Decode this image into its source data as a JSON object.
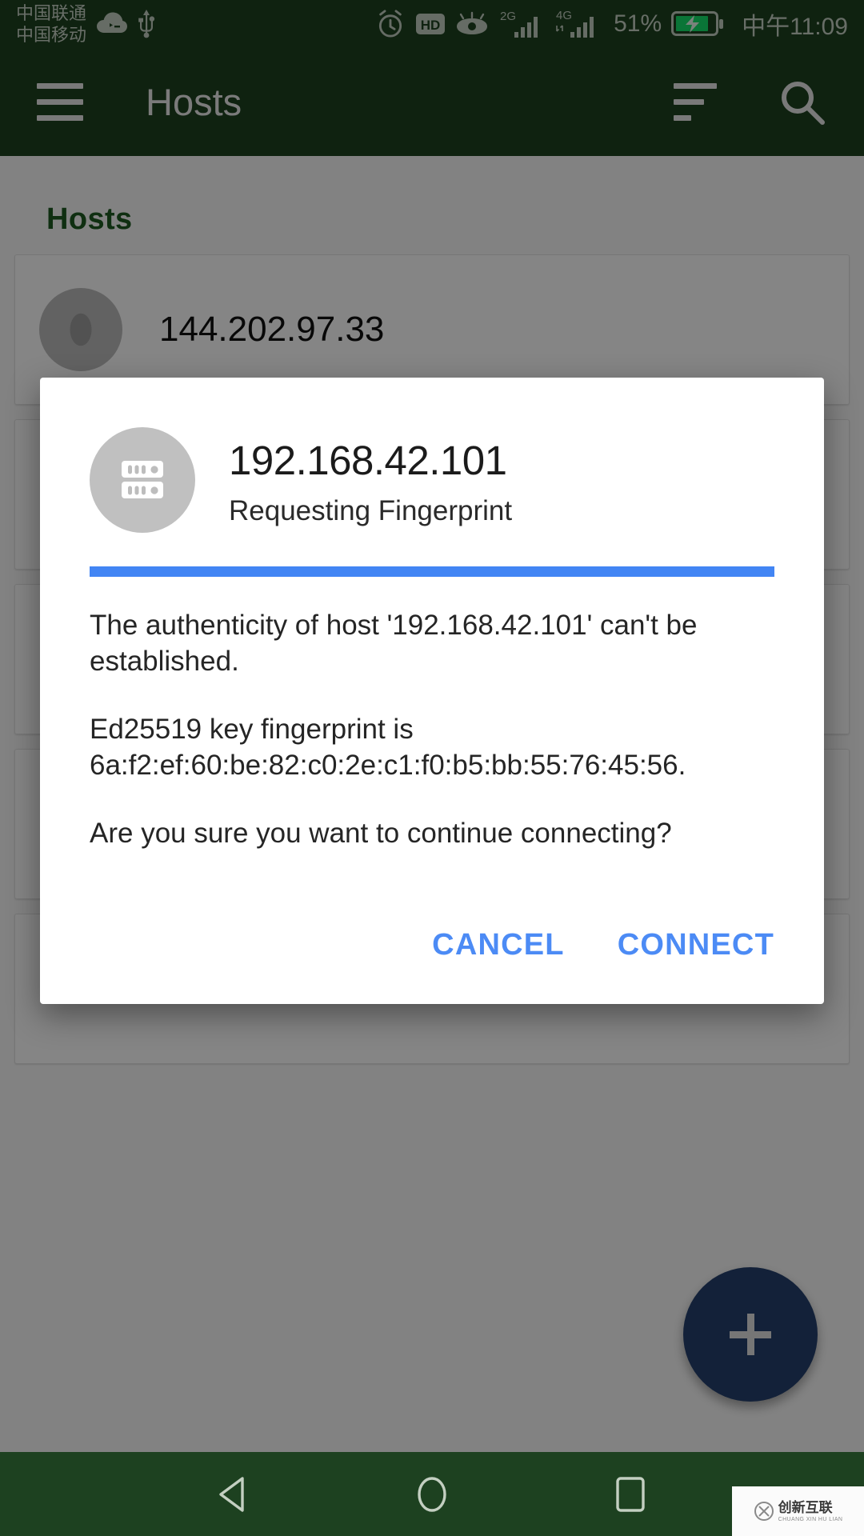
{
  "status_bar": {
    "carrier_line1": "中国联通",
    "carrier_line2": "中国移动",
    "icons": [
      "weather-cloud-icon",
      "usb-icon",
      "alarm-icon",
      "hd-icon",
      "eye-icon",
      "signal-2g-icon",
      "signal-4g-icon"
    ],
    "network_2g_label": "2G",
    "network_4g_label": "4G",
    "battery_percent": "51%",
    "battery_state": "charging",
    "time": "中午11:09"
  },
  "app_bar": {
    "menu_icon": "hamburger-menu-icon",
    "title": "Hosts",
    "sort_icon": "sort-icon",
    "search_icon": "search-icon"
  },
  "content": {
    "section_title": "Hosts",
    "hosts": [
      {
        "label": "144.202.97.33"
      },
      {
        "label": ""
      },
      {
        "label": ""
      },
      {
        "label": ""
      },
      {
        "label": ""
      }
    ],
    "fab_label": "+"
  },
  "dialog": {
    "icon": "server-icon",
    "title": "192.168.42.101",
    "subtitle": "Requesting Fingerprint",
    "accent_color": "#4285f4",
    "paragraphs": [
      "The authenticity of host '192.168.42.101' can't be established.",
      "Ed25519 key fingerprint is 6a:f2:ef:60:be:82:c0:2e:c1:f0:b5:bb:55:76:45:56.",
      "Are you sure you want to continue connecting?"
    ],
    "cancel_label": "CANCEL",
    "connect_label": "CONNECT"
  },
  "nav_bar": {
    "back_icon": "back-triangle-icon",
    "home_icon": "home-circle-icon",
    "recents_icon": "recents-square-icon"
  },
  "watermark": {
    "cn": "创新互联",
    "en": "CHUANG XIN HU LIAN"
  }
}
